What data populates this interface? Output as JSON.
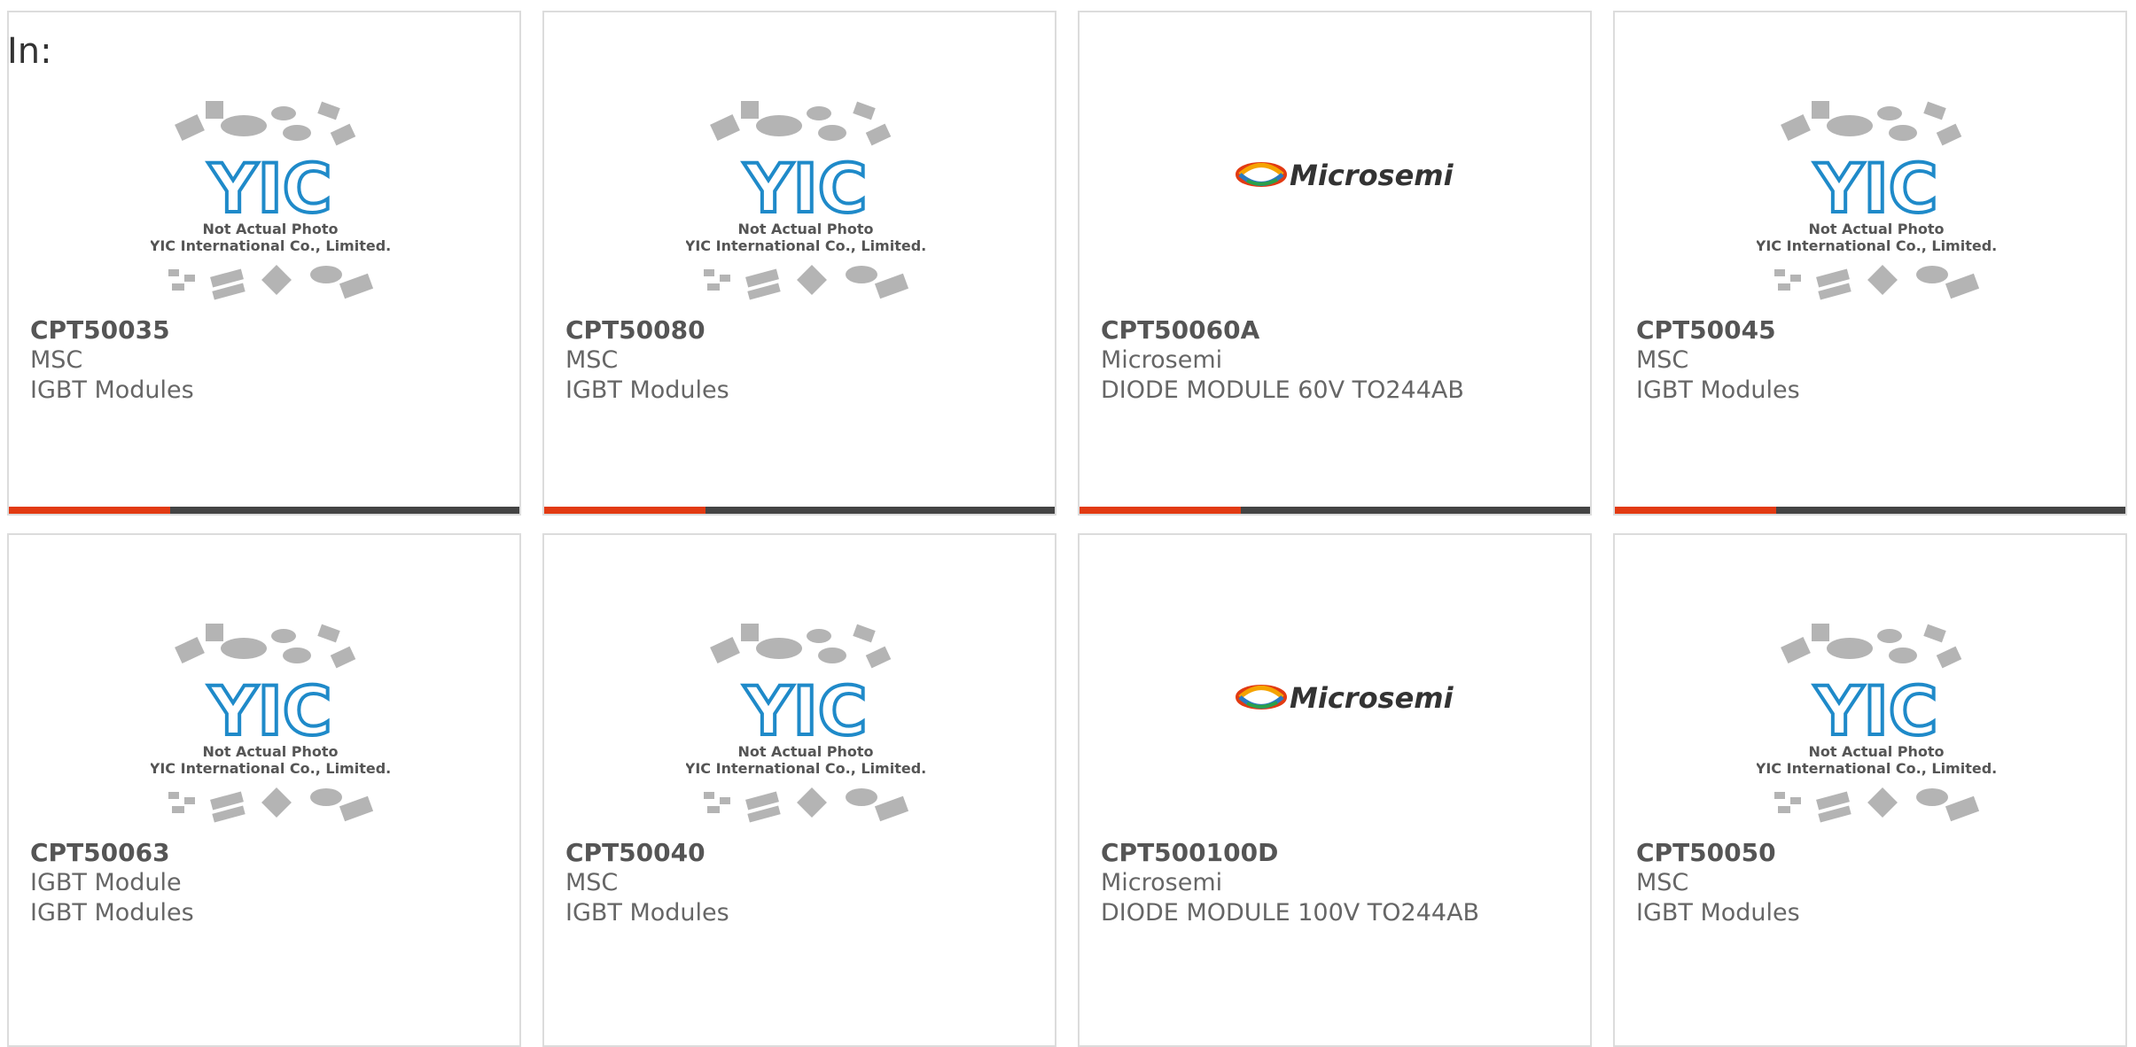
{
  "header": {
    "label": "In:"
  },
  "placeholder": {
    "brand": "YIC",
    "line1": "Not Actual Photo",
    "line2": "YIC International Co., Limited."
  },
  "microsemi_logo_text": "Microsemi",
  "colors": {
    "accent": "#e23a12",
    "bar": "#444444",
    "border": "#dcdcdc",
    "yic_blue": "#1f8ac9"
  },
  "products": [
    {
      "part": "CPT50035",
      "maker": "MSC",
      "desc": "IGBT Modules",
      "image": "yic-placeholder"
    },
    {
      "part": "CPT50080",
      "maker": "MSC",
      "desc": "IGBT Modules",
      "image": "yic-placeholder"
    },
    {
      "part": "CPT50060A",
      "maker": "Microsemi",
      "desc": "DIODE MODULE 60V TO244AB",
      "image": "microsemi-logo"
    },
    {
      "part": "CPT50045",
      "maker": "MSC",
      "desc": "IGBT Modules",
      "image": "yic-placeholder"
    },
    {
      "part": "CPT50063",
      "maker": "IGBT Module",
      "desc": "IGBT Modules",
      "image": "yic-placeholder"
    },
    {
      "part": "CPT50040",
      "maker": "MSC",
      "desc": "IGBT Modules",
      "image": "yic-placeholder"
    },
    {
      "part": "CPT500100D",
      "maker": "Microsemi",
      "desc": "DIODE MODULE 100V TO244AB",
      "image": "microsemi-logo"
    },
    {
      "part": "CPT50050",
      "maker": "MSC",
      "desc": "IGBT Modules",
      "image": "yic-placeholder"
    }
  ]
}
